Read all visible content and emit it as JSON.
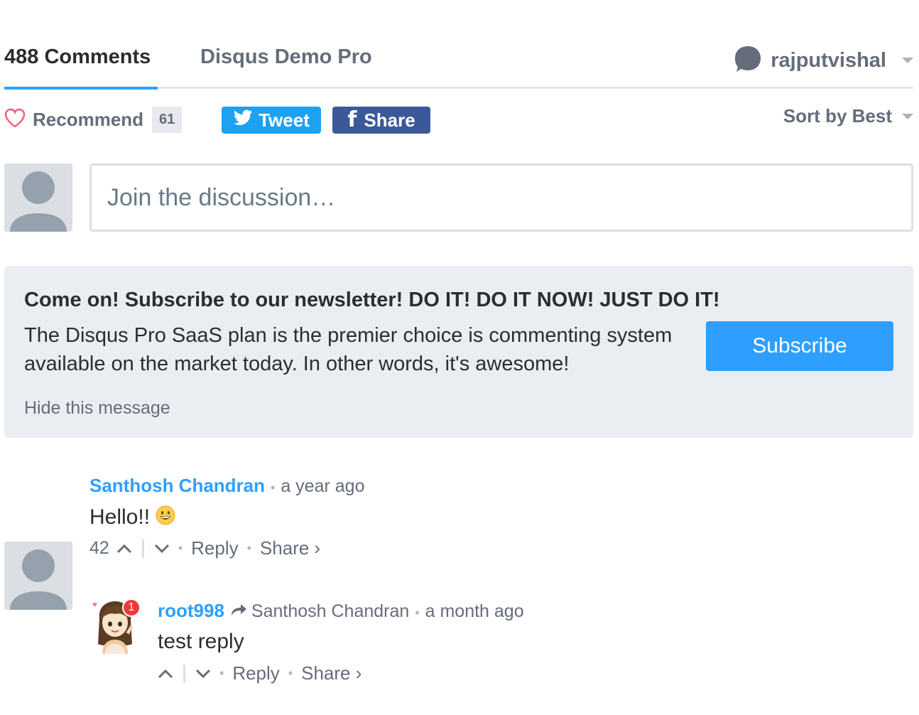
{
  "nav": {
    "comments_tab": "488 Comments",
    "site_tab": "Disqus Demo Pro",
    "username": "rajputvishal",
    "user_icon": "speech-bubble-icon",
    "accent_color": "#2e9fff"
  },
  "actions": {
    "recommend_label": "Recommend",
    "recommend_count": "61",
    "tweet_label": "Tweet",
    "share_label": "Share",
    "sort_label": "Sort by Best",
    "tweet_color": "#1da1f2",
    "facebook_color": "#3b5998"
  },
  "composer": {
    "placeholder": "Join the discussion…"
  },
  "promo": {
    "title": "Come on! Subscribe to our newsletter! DO IT! DO IT NOW! JUST DO IT!",
    "body": "The Disqus Pro SaaS plan is the premier choice is commenting system available on the market today. In other words, it's awesome!",
    "button_label": "Subscribe",
    "hide_label": "Hide this message"
  },
  "comments": [
    {
      "author": "Santhosh Chandran",
      "time": "a year ago",
      "body": "Hello!!",
      "emoji": "😀",
      "upvotes": "42",
      "reply_label": "Reply",
      "share_label": "Share ›"
    },
    {
      "author": "root998",
      "in_reply_to": "Santhosh Chandran",
      "time": "a month ago",
      "body": "test reply",
      "notification_badge": "1",
      "reply_label": "Reply",
      "share_label": "Share ›"
    }
  ]
}
